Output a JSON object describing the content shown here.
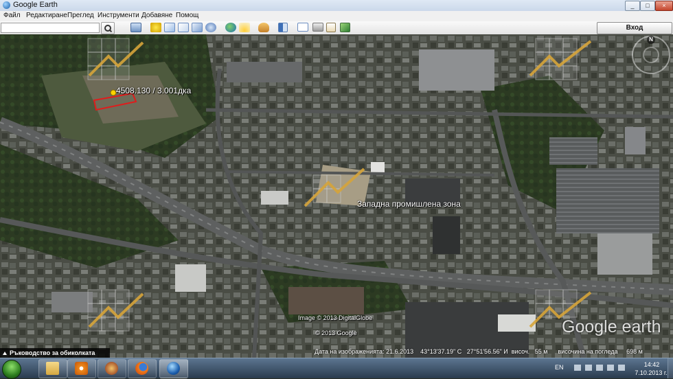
{
  "window": {
    "title": "Google Earth",
    "minimize": "_",
    "maximize": "□",
    "close": "×"
  },
  "menu": [
    "Файл",
    "Редактиране",
    "Преглед",
    "Инструменти",
    "Добавяне",
    "Помощ"
  ],
  "toolbar": {
    "search_value": "",
    "sign_in_label": "Вход"
  },
  "map": {
    "placemark_label": "4508.130 / 3.001дка",
    "zone_label": "Западна промишлена зона",
    "copyright_1": "Image © 2013 DigitalGlobe",
    "copyright_2": "© 2013 Google",
    "logo": "Google earth",
    "compass_north": "N",
    "tour_guide": "Ръководство за обиколката"
  },
  "status": {
    "imagery_date_label": "Дата на изображенията:",
    "imagery_date": "21.6.2013",
    "lat": "43°13'37.19\" С",
    "lon": "27°51'56.56\" И",
    "elevation_label": "височ.",
    "elevation": "55 м",
    "eye_alt_label": "височина на погледа",
    "eye_alt": "698 м"
  },
  "taskbar": {
    "language": "EN",
    "time": "14:42",
    "date": "7.10.2013 г."
  },
  "colors": {
    "accent_polygon": "#e01c1c",
    "placemark": "#ffd400",
    "overlay_lines": "#d6a43a"
  }
}
